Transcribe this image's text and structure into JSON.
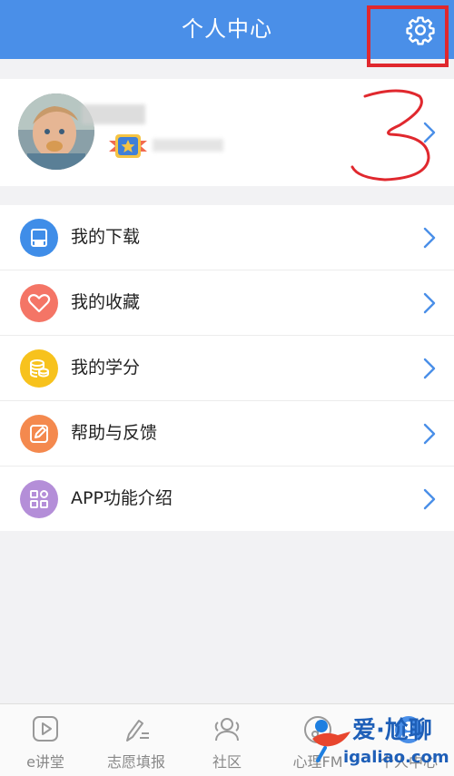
{
  "header": {
    "title": "个人中心"
  },
  "menu": {
    "items": [
      {
        "label": "我的下载",
        "color": "#3f8de8"
      },
      {
        "label": "我的收藏",
        "color": "#f47566"
      },
      {
        "label": "我的学分",
        "color": "#f7c21d"
      },
      {
        "label": "帮助与反馈",
        "color": "#f4894e"
      },
      {
        "label": "APP功能介绍",
        "color": "#b48ed8"
      }
    ]
  },
  "annotation": {
    "text": "3"
  },
  "tabs": [
    {
      "label": "e讲堂"
    },
    {
      "label": "志愿填报"
    },
    {
      "label": "社区"
    },
    {
      "label": "心理FM"
    },
    {
      "label": "个人中心"
    }
  ],
  "watermark": {
    "line1": "爱·尬聊",
    "line2": "igaliao.com"
  },
  "colors": {
    "header": "#4a8fe8",
    "annotation": "#e0282e",
    "chevron": "#4a8fe8"
  }
}
